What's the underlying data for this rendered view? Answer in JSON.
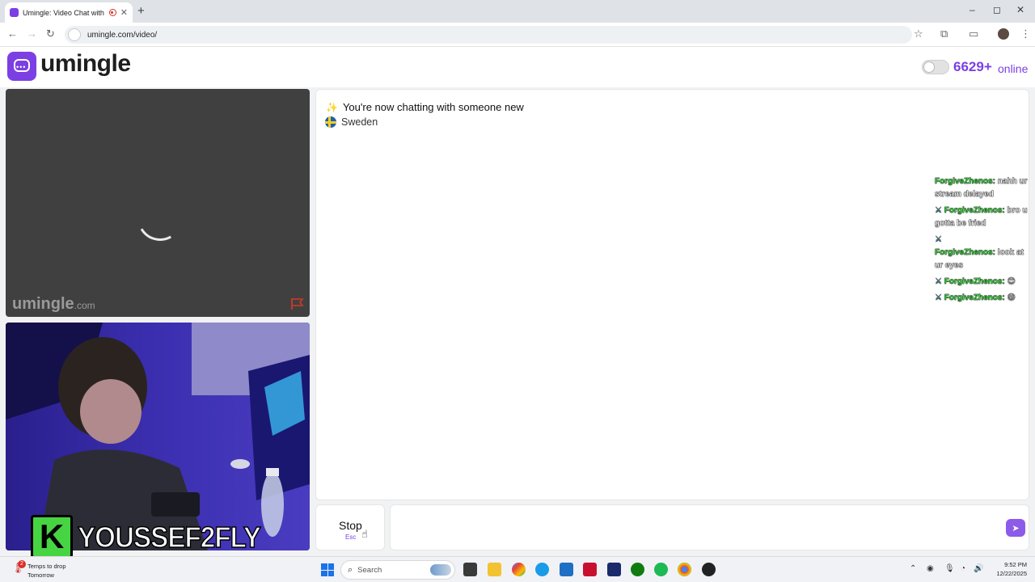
{
  "browser": {
    "tab_title": "Umingle: Video Chat with S",
    "tab_close": "✕",
    "new_tab": "+",
    "url": "umingle.com/video/",
    "window_controls": [
      "–",
      "◻",
      "✕"
    ]
  },
  "header": {
    "logo_text": "umingle",
    "online_count": "6629+",
    "online_label": "online"
  },
  "remote_video": {
    "watermark": "umingle",
    "watermark_suffix": ".com"
  },
  "stream_overlay": {
    "badge_letter": "K",
    "streamer_name": "YOUSSEF2FLY"
  },
  "chat": {
    "status_line": "You're now chatting with someone new",
    "country": "Sweden"
  },
  "stream_chat": [
    {
      "user": "ForgiveZhenos:",
      "text": "nahh ur stream delayed"
    },
    {
      "user": "ForgiveZhenos:",
      "text": "bro u gotta be fried"
    },
    {
      "user": "ForgiveZhenos:",
      "text": "look at ur eyes"
    },
    {
      "user": "ForgiveZhenos:",
      "text": "😊"
    },
    {
      "user": "ForgiveZhenos:",
      "text": "😁"
    }
  ],
  "controls": {
    "stop_label": "Stop",
    "stop_key": "Esc",
    "message_placeholder": ""
  },
  "taskbar": {
    "weather_badge": "2",
    "weather_line1": "Temps to drop",
    "weather_line2": "Tomorrow",
    "search_placeholder": "Search",
    "time": "9:52 PM",
    "date": "12/22/2025"
  },
  "colors": {
    "brand_purple": "#7b3fe4",
    "chat_user_green": "#35e23a",
    "overlay_green": "#47d443"
  }
}
